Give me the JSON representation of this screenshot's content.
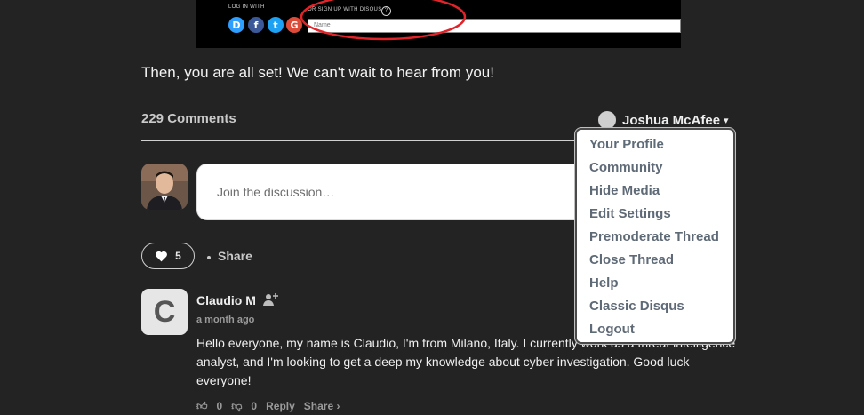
{
  "embedded_image": {
    "login_label": "LOG IN WITH",
    "signup_label": "OR SIGN UP WITH DISQUS",
    "help_glyph": "?",
    "name_placeholder": "Name",
    "providers": [
      {
        "name": "disqus-icon",
        "glyph": "D",
        "color": "#2e9fff"
      },
      {
        "name": "facebook-icon",
        "glyph": "f",
        "color": "#3b5998"
      },
      {
        "name": "twitter-icon",
        "glyph": "t",
        "color": "#1da1f2"
      },
      {
        "name": "google-icon",
        "glyph": "G",
        "color": "#dd4b39"
      }
    ],
    "highlight_color": "#e0242a"
  },
  "intro_text": "Then, you are all set! We can't wait to hear from you!",
  "comments": {
    "count_label": "229 Comments",
    "user_name": "Joshua McAfee",
    "caret": "▾",
    "reply_placeholder": "Join the discussion…",
    "likes": "5",
    "share_label": "Share"
  },
  "user_menu": {
    "items": [
      "Your Profile",
      "Community",
      "Hide Media",
      "Edit Settings",
      "Premoderate Thread",
      "Close Thread",
      "Help",
      "Classic Disqus",
      "Logout"
    ]
  },
  "comment": {
    "avatar_letter": "C",
    "author": "Claudio M",
    "time": "a month ago",
    "body": "Hello everyone, my name is Claudio, I'm from Milano, Italy. I currently work as a threat intelligence analyst, and I'm looking to get a deep my knowledge about cyber investigation. Good luck everyone!",
    "upvotes": "0",
    "downvotes": "0",
    "reply_label": "Reply",
    "share_label": "Share ›"
  },
  "colors": {
    "background": "#232323",
    "menu_text": "#5f6a77"
  }
}
